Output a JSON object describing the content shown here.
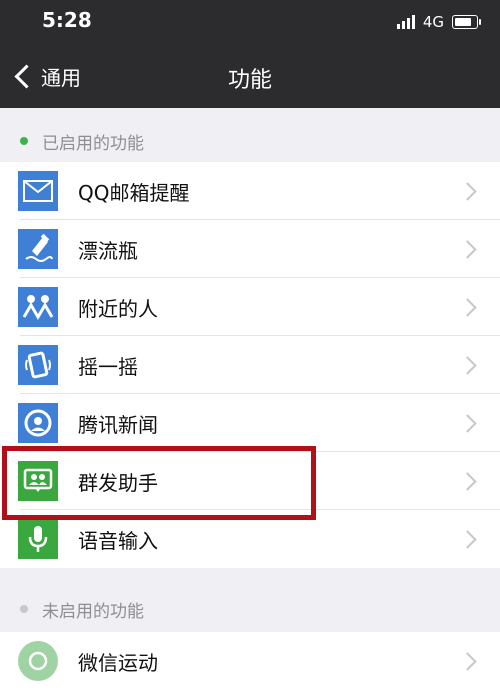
{
  "status": {
    "time": "5:28",
    "network": "4G",
    "battery_level": 0.8
  },
  "nav": {
    "back_label": "通用",
    "title": "功能"
  },
  "enabled_section": {
    "title": "已启用的功能",
    "items": [
      {
        "label": "QQ邮箱提醒",
        "icon": "mail-icon",
        "color": "#3f7fd6"
      },
      {
        "label": "漂流瓶",
        "icon": "drift-bottle-icon",
        "color": "#3f7fd6"
      },
      {
        "label": "附近的人",
        "icon": "people-nearby-icon",
        "color": "#3f7fd6"
      },
      {
        "label": "摇一摇",
        "icon": "shake-icon",
        "color": "#3f7fd6"
      },
      {
        "label": "腾讯新闻",
        "icon": "news-icon",
        "color": "#3f7fd6"
      },
      {
        "label": "群发助手",
        "icon": "broadcast-icon",
        "color": "#3aa83f"
      },
      {
        "label": "语音输入",
        "icon": "microphone-icon",
        "color": "#3aa83f"
      }
    ]
  },
  "disabled_section": {
    "title": "未启用的功能",
    "items": [
      {
        "label": "微信运动",
        "icon": "werun-icon",
        "color": "#3aa83f"
      }
    ]
  },
  "colors": {
    "enabled_dot": "#3cb34a",
    "disabled_dot": "#c7c7cc",
    "highlight": "#b0101a"
  }
}
